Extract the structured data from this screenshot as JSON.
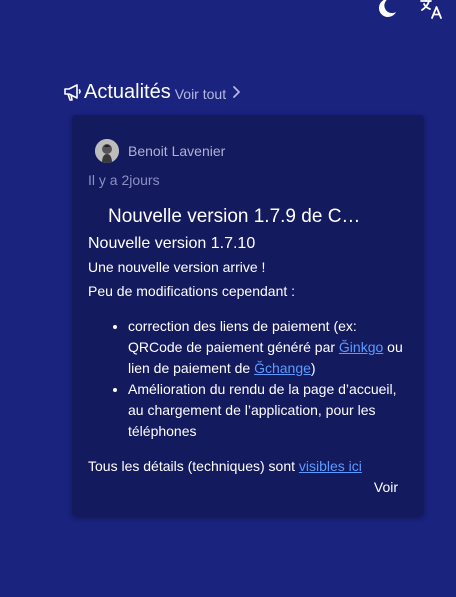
{
  "toolbar": {
    "theme_icon": "moon-icon",
    "language_icon": "translate-icon"
  },
  "news": {
    "icon": "megaphone-icon",
    "title": "Actualités",
    "see_all": "Voir tout",
    "chevron_icon": "chevron-right-icon"
  },
  "card": {
    "author": "Benoit Lavenier",
    "time": "Il y a 2jours",
    "title": "Nouvelle version 1.7.9 de C…",
    "subtitle": "Nouvelle version 1.7.10",
    "para1": "Une nouvelle version arrive !",
    "para2": "Peu de modifications cependant :",
    "bullet1": {
      "text_before": "correction des liens de paiement (ex: QRCode de paiement généré par ",
      "link1": "Ğinkgo",
      "text_middle": " ou lien de paiement de ",
      "link2": "Ğchange",
      "text_after": ")"
    },
    "bullet2": "Amélioration du rendu de la page d’accueil, au chargement de l’application, pour les téléphones",
    "details_text": "Tous les détails (techniques) sont ",
    "details_link": "visibles ici",
    "view_button": "Voir"
  },
  "colors": {
    "background": "#1a237e",
    "card": "#141a5e",
    "link": "#5b9bff"
  }
}
